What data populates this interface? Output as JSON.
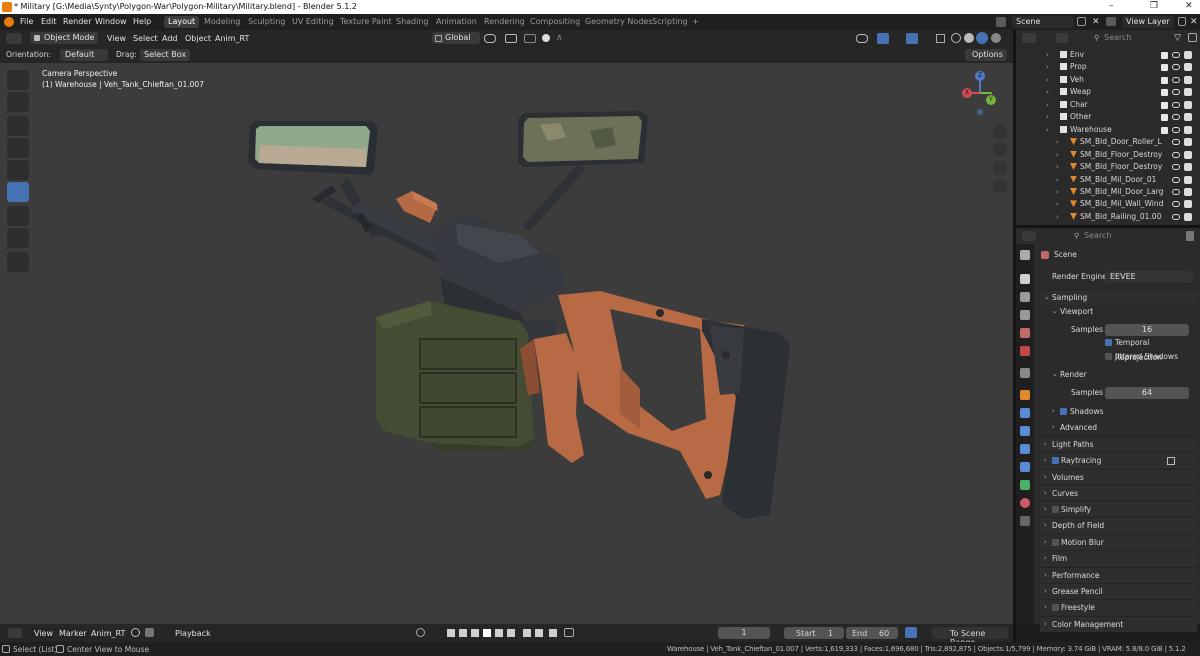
{
  "window": {
    "title": "* Military [G:\\Media\\Synty\\Polygon-War\\Polygon-Military\\Military.blend] - Blender 5.1.2",
    "controls": [
      "–",
      "❐",
      "✕"
    ]
  },
  "menu": [
    "File",
    "Edit",
    "Render",
    "Window",
    "Help"
  ],
  "workspaces": [
    "Layout",
    "Modeling",
    "Sculpting",
    "UV Editing",
    "Texture Paint",
    "Shading",
    "Animation",
    "Rendering",
    "Compositing",
    "Geometry Nodes",
    "Scripting",
    "+"
  ],
  "active_workspace": "Layout",
  "scene_selector": {
    "value": "Scene"
  },
  "view_layer": {
    "value": "View Layer"
  },
  "viewport": {
    "header": {
      "mode": "Object Mode",
      "menus": [
        "View",
        "Select",
        "Add",
        "Object",
        "Anim_RT"
      ],
      "transform_orientation": "Global"
    },
    "tool_settings": {
      "orientation_label": "Orientation:",
      "orientation_value": "Default",
      "drag_label": "Drag:",
      "drag_value": "Select Box",
      "options_label": "Options"
    },
    "overlay_text": {
      "line1": "Camera Perspective",
      "line2": "(1) Warehouse | Veh_Tank_Chieftan_01.007"
    },
    "gizmo_axes": {
      "x": "X",
      "y": "Y",
      "z": "Z"
    }
  },
  "outliner": {
    "search_placeholder": "Search",
    "rows": [
      {
        "label": "Env",
        "icon": "collection-icon"
      },
      {
        "label": "Prop",
        "icon": "collection-icon"
      },
      {
        "label": "Veh",
        "icon": "collection-icon"
      },
      {
        "label": "Weap",
        "icon": "collection-icon"
      },
      {
        "label": "Char",
        "icon": "collection-icon"
      },
      {
        "label": "Other",
        "icon": "collection-icon"
      },
      {
        "label": "Warehouse",
        "icon": "collection-icon"
      },
      {
        "label": "SM_Bld_Door_Roller_L",
        "icon": "object-icon"
      },
      {
        "label": "SM_Bld_Floor_Destroy",
        "icon": "object-icon"
      },
      {
        "label": "SM_Bld_Floor_Destroy",
        "icon": "object-icon"
      },
      {
        "label": "SM_Bld_Mil_Door_01",
        "icon": "object-icon"
      },
      {
        "label": "SM_Bld_Mil_Door_Larg",
        "icon": "object-icon"
      },
      {
        "label": "SM_Bld_Mil_Wall_Wind",
        "icon": "object-icon"
      },
      {
        "label": "SM_Bld_Railing_01.00",
        "icon": "object-icon"
      }
    ]
  },
  "properties": {
    "search_placeholder": "Search",
    "context": "Scene",
    "render_engine_label": "Render Engine",
    "render_engine_value": "EEVEE",
    "sampling": {
      "title": "Sampling",
      "viewport_title": "Viewport",
      "samples_label": "Samples",
      "viewport_samples": "16",
      "temporal_reprojection": "Temporal Reprojection",
      "jittered_shadows": "Jittered Shadows",
      "render_title": "Render",
      "render_samples_label": "Samples",
      "render_samples": "64",
      "shadows": "Shadows",
      "advanced": "Advanced"
    },
    "panels": [
      "Light Paths",
      "Raytracing",
      "Volumes",
      "Curves",
      "Simplify",
      "Depth of Field",
      "Motion Blur",
      "Film",
      "Performance",
      "Grease Pencil",
      "Freestyle",
      "Color Management"
    ]
  },
  "timeline": {
    "menus": [
      "View",
      "Marker",
      "Anim_RT"
    ],
    "playback_label": "Playback",
    "current_frame": "1",
    "start_label": "Start",
    "start_value": "1",
    "end_label": "End",
    "end_value": "60",
    "scene_range_label": "To Scene Range"
  },
  "status_bar": {
    "left_hint1": "Select (List)",
    "left_hint2": "Center View to Mouse",
    "stats": "Warehouse | Veh_Tank_Chieftan_01.007 | Verts:1,619,333 | Faces:1,696,680 | Tris:2,892,875 | Objects:1/5,799 | Memory: 3.74 GiB | VRAM: 5.8/8.0 GiB | 5.1.2"
  },
  "colors": {
    "accent_blue": "#4772b3",
    "blender_orange": "#e87d0d",
    "viewport_bg": "#3c3c3c",
    "panel_bg": "#2b2b2b",
    "wood": "#b86a45",
    "metal": "#3b3f45",
    "ammo_box": "#434a33"
  }
}
